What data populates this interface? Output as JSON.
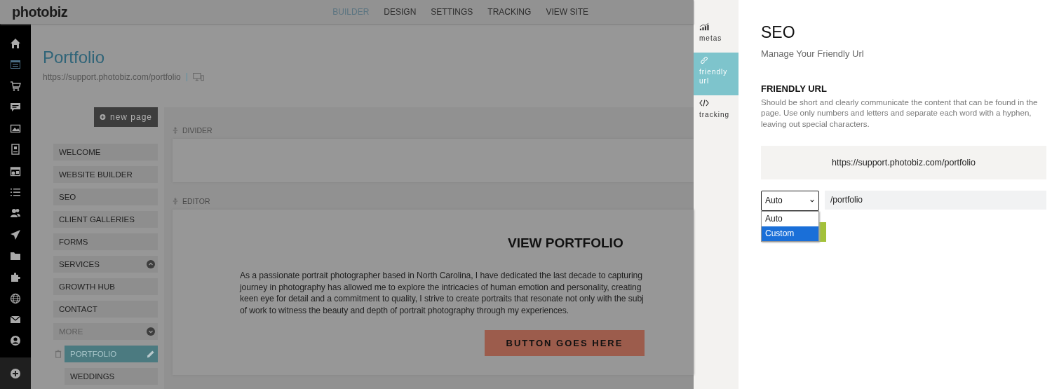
{
  "header": {
    "logo": "photobiz",
    "nav": [
      {
        "label": "BUILDER",
        "selected": true
      },
      {
        "label": "DESIGN",
        "selected": false
      },
      {
        "label": "SETTINGS",
        "selected": false
      },
      {
        "label": "TRACKING",
        "selected": false
      },
      {
        "label": "VIEW SITE",
        "selected": false
      }
    ]
  },
  "sidebar_icons": [
    {
      "selected": false
    },
    {
      "selected": true
    },
    {
      "selected": false
    },
    {
      "selected": false
    },
    {
      "selected": false
    },
    {
      "selected": false
    },
    {
      "selected": false
    },
    {
      "selected": false
    },
    {
      "selected": false
    },
    {
      "selected": false
    },
    {
      "selected": false
    },
    {
      "selected": false
    },
    {
      "selected": false
    },
    {
      "selected": false
    },
    {
      "selected": false
    }
  ],
  "page": {
    "title": "Portfolio",
    "url": "https://support.photobiz.com/portfolio"
  },
  "new_page_button": "new page",
  "pages": [
    {
      "label": "WELCOME",
      "selected": false
    },
    {
      "label": "WEBSITE BUILDER",
      "selected": false
    },
    {
      "label": "SEO",
      "selected": false
    },
    {
      "label": "CLIENT GALLERIES",
      "selected": false
    },
    {
      "label": "FORMS",
      "selected": false
    },
    {
      "label": "SERVICES",
      "selected": false,
      "expanded": false
    },
    {
      "label": "GROWTH HUB",
      "selected": false
    },
    {
      "label": "CONTACT",
      "selected": false
    },
    {
      "label": "MORE",
      "selected": false,
      "expanded": true,
      "children": [
        {
          "label": "PORTFOLIO",
          "selected": true
        },
        {
          "label": "WEDDINGS",
          "selected": false
        }
      ]
    }
  ],
  "sections": [
    {
      "kind": "divider",
      "label": "DIVIDER"
    },
    {
      "kind": "editor",
      "label": "EDITOR",
      "heading": "VIEW PORTFOLIO",
      "lines": [
        "As a passionate portrait photographer based in North Carolina, I have dedicated the last decade to capturing",
        "journey in photography has allowed me to explore the intricacies of human emotion and personality, creating",
        "keen eye for detail and a commitment to quality, I strive to create portraits that resonate not only with the subj",
        "of work to witness the beauty and depth of portrait photography through my experiences."
      ],
      "button": "BUTTON GOES HERE"
    }
  ],
  "panel": {
    "tabs": [
      {
        "label": "metas",
        "selected": false
      },
      {
        "label": "friendly url",
        "selected": true
      },
      {
        "label": "tracking",
        "selected": false
      }
    ],
    "title": "SEO",
    "subtitle": "Manage Your Friendly Url",
    "section_title": "FRIENDLY URL",
    "description": "Should be short and clearly communicate the content that can be found in the page. Use only numbers and letters and separate each word with a hyphen, leaving out special characters.",
    "full_url": "https://support.photobiz.com/portfolio",
    "mode_select": {
      "value": "Auto",
      "expanded": true,
      "options": [
        {
          "label": "Auto",
          "highlighted": false
        },
        {
          "label": "Custom",
          "highlighted": true
        }
      ]
    },
    "slug_field": {
      "value": "/portfolio"
    }
  }
}
